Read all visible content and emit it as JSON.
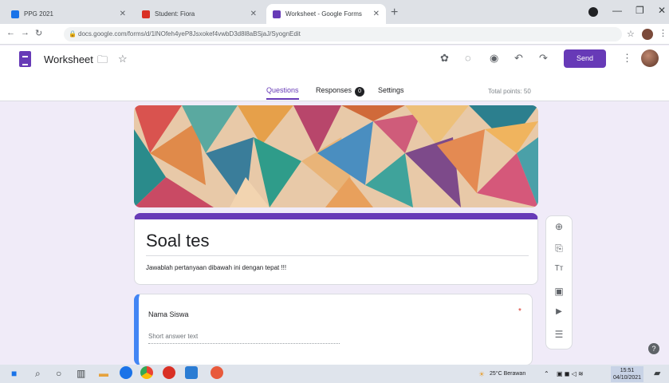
{
  "browser": {
    "tabs": [
      {
        "title": "PPG 2021",
        "favicon_color": "#1a73e8"
      },
      {
        "title": "Student: Fiora",
        "favicon_color": "#d93025"
      },
      {
        "title": "Worksheet - Google Forms",
        "favicon_color": "#673ab7"
      }
    ],
    "url": "docs.google.com/forms/d/1lNOfeh4yeP8Jsxokef4vwbD3d8l8aBSjaJ/SyognEdit",
    "window_controls": [
      "—",
      "❐",
      "✕"
    ]
  },
  "forms_header": {
    "title": "Worksheet",
    "send_label": "Send",
    "tabs": [
      {
        "label": "Questions",
        "active": true
      },
      {
        "label": "Responses",
        "badge": "0"
      },
      {
        "label": "Settings"
      }
    ],
    "total_points": "Total points: 50",
    "icons": [
      "palette-icon",
      "preview-eye-icon",
      "undo-icon",
      "redo-icon",
      "more-vert-icon"
    ]
  },
  "form": {
    "title": "Soal tes",
    "description": "Jawablah pertanyaan dibawah ini dengan tepat !!!",
    "question": {
      "label": "Nama Siswa",
      "required_mark": "*",
      "placeholder": "Short answer text"
    }
  },
  "side_toolbar": [
    "add-question-icon",
    "import-questions-icon",
    "add-title-icon",
    "add-image-icon",
    "add-video-icon",
    "add-section-icon"
  ],
  "side_toolbar_glyphs": [
    "⊕",
    "⎘",
    "Tт",
    "▣",
    "▶",
    "☰"
  ],
  "taskbar": {
    "weather": "25°C Berawan",
    "time": "15:51",
    "date": "04/10/2021"
  },
  "colors": {
    "accent": "#673ab7",
    "background": "#f0ebf8",
    "question_accent": "#4285f4"
  }
}
